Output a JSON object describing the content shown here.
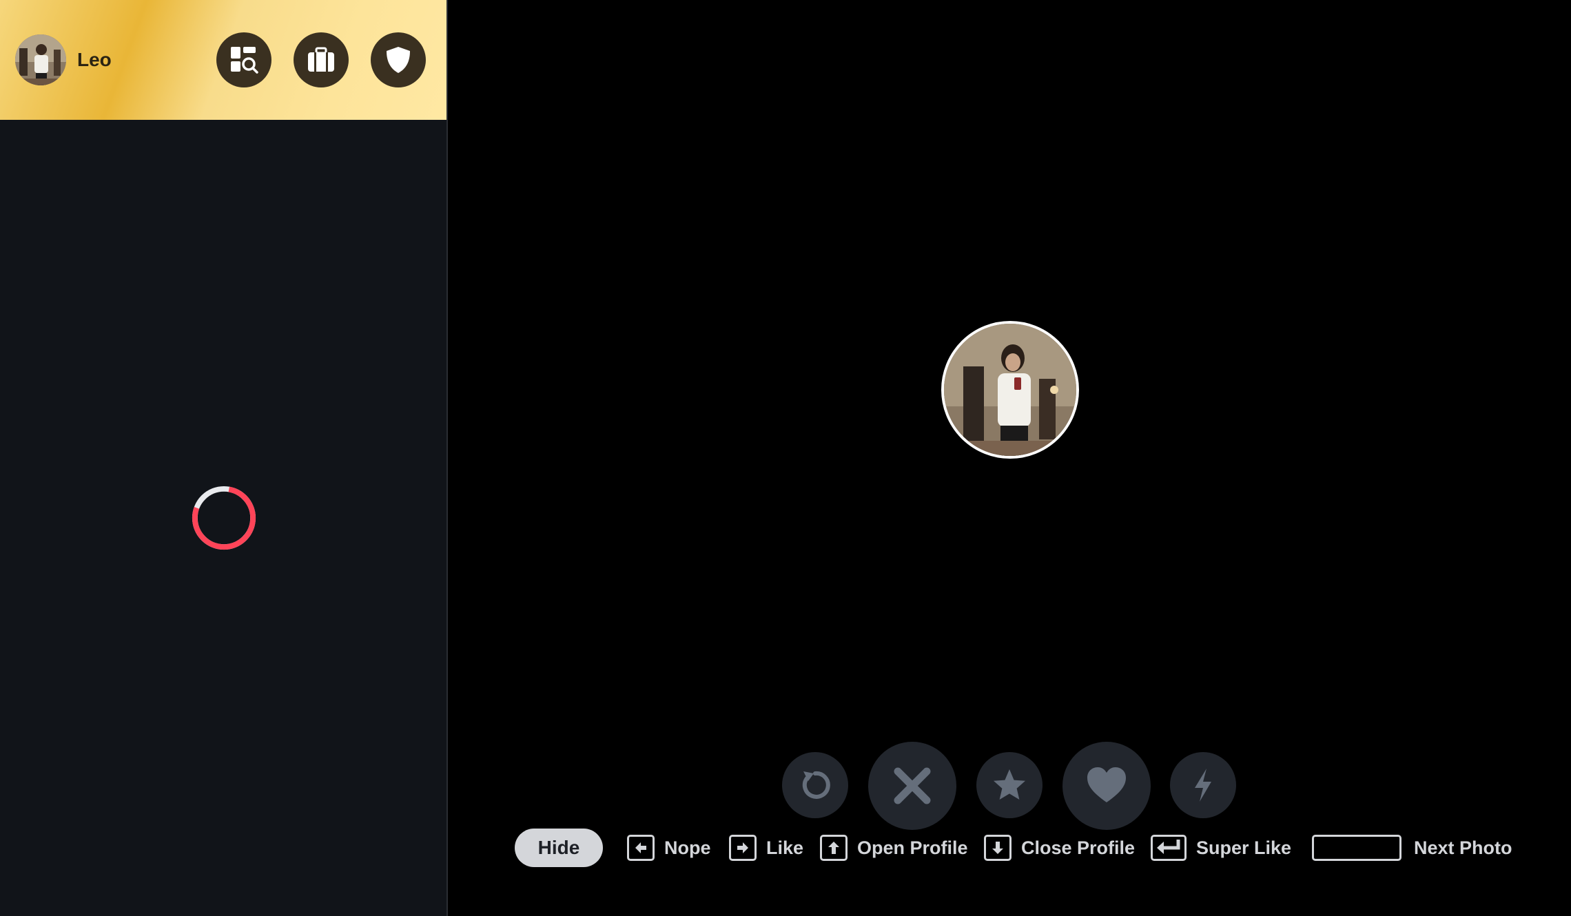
{
  "user": {
    "name": "Leo"
  },
  "header_buttons": [
    {
      "name": "explore",
      "icon": "explore-icon"
    },
    {
      "name": "passport",
      "icon": "briefcase-icon"
    },
    {
      "name": "safety",
      "icon": "shield-icon"
    }
  ],
  "loading": {
    "spinner_color": "#ff4458"
  },
  "action_buttons": [
    {
      "name": "rewind",
      "icon": "rewind-icon"
    },
    {
      "name": "nope",
      "icon": "x-icon"
    },
    {
      "name": "super-like",
      "icon": "star-icon"
    },
    {
      "name": "like",
      "icon": "heart-icon"
    },
    {
      "name": "boost",
      "icon": "lightning-icon"
    }
  ],
  "shortcuts": {
    "hide_label": "Hide",
    "items": [
      {
        "key": "left-arrow-key",
        "label": "Nope"
      },
      {
        "key": "right-arrow-key",
        "label": "Like"
      },
      {
        "key": "up-arrow-key",
        "label": "Open Profile"
      },
      {
        "key": "down-arrow-key",
        "label": "Close Profile"
      },
      {
        "key": "enter-key",
        "label": "Super Like"
      },
      {
        "key": "space-key",
        "label": "Next Photo"
      }
    ]
  },
  "colors": {
    "header_gold": "#f5c94f",
    "sidebar_bg": "#111419",
    "main_bg": "#000000",
    "button_bg": "#22262d",
    "icon_muted": "#656e7b",
    "shortcut_text": "#d4d6da"
  }
}
